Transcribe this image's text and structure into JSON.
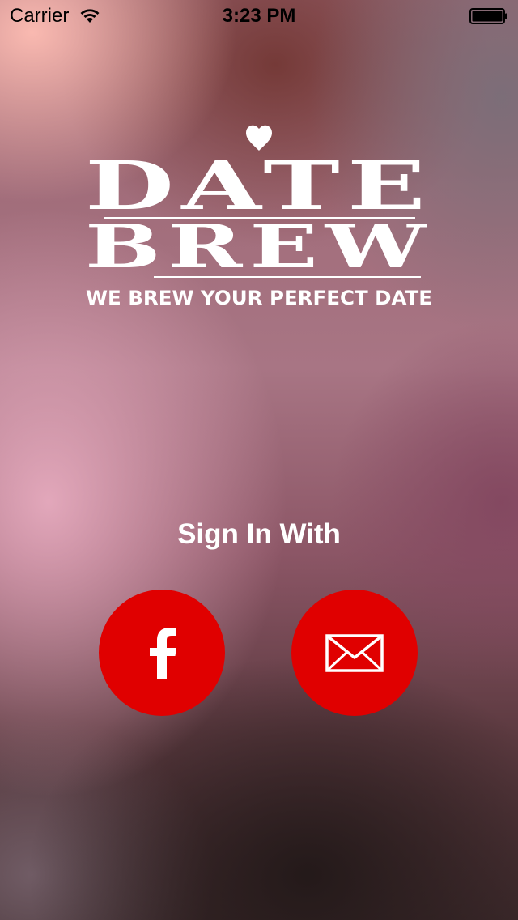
{
  "status_bar": {
    "carrier": "Carrier",
    "time": "3:23 PM",
    "wifi_icon": "wifi-icon",
    "battery_icon": "battery-icon"
  },
  "logo": {
    "line1": "DATE",
    "line2": "BREW",
    "tagline": "WE BREW YOUR PERFECT DATE",
    "icon": "heart-icon"
  },
  "sign_in": {
    "label": "Sign In With",
    "buttons": [
      {
        "icon": "facebook-icon"
      },
      {
        "icon": "envelope-icon"
      }
    ]
  },
  "colors": {
    "button": "#e00000",
    "text": "#ffffff"
  }
}
